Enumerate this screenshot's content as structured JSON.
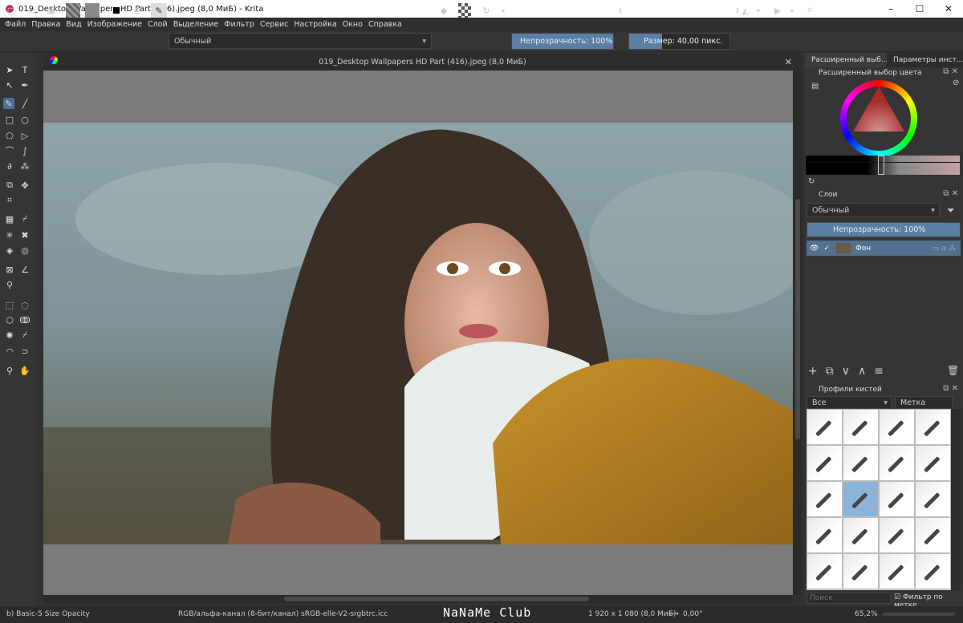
{
  "window": {
    "title": "019_Desktop Wallpapers  HD Part (416).jpeg (8,0 МиБ)  - Krita",
    "minimize": "–",
    "maximize": "☐",
    "close": "✕"
  },
  "menu": [
    "Файл",
    "Правка",
    "Вид",
    "Изображение",
    "Слой",
    "Выделение",
    "Фильтр",
    "Сервис",
    "Настройка",
    "Окно",
    "Справка"
  ],
  "toolbar": {
    "blend_mode": "Обычный",
    "opacity": "Непрозрачность: 100%",
    "opacity_value": 100,
    "size": "Размер: 40,00 пикс.",
    "size_fill": 0.33
  },
  "document": {
    "title": "019_Desktop Wallpapers  HD Part (416).jpeg (8,0 МиБ)",
    "close": "✕"
  },
  "dock": {
    "tab1": "Расширенный выб...",
    "tab2": "Параметры инст...",
    "color_title": "Расширенный выбор цвета",
    "layers_title": "Слои",
    "layers_blend": "Обычный",
    "layers_opacity": "Непрозрачность:  100%",
    "layer_name": "Фон",
    "brush_title": "Профили кистей",
    "brush_filter": "Все",
    "brush_tag": "Метка",
    "search_placeholder": "Поиск",
    "filter_by_tag": "Фильтр по метке"
  },
  "status": {
    "brush": "b) Basic-5 Size Opacity",
    "color_space": "RGB/альфа-канал (8-бит/канал)  sRGB-elle-V2-srgbtrc.icc",
    "watermark": "NaNaMe Club",
    "dimensions": "1 920 x 1 080 (8,0 МиБ)",
    "rotation": "0,00°",
    "zoom": "65,2%"
  },
  "colors": {
    "accent": "#5b7ea5",
    "panel": "#353535",
    "canvas_bg": "#7b7b7b"
  }
}
